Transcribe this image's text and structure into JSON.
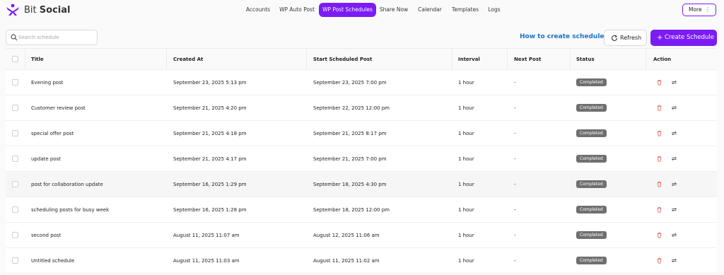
{
  "app": {
    "brand_part1": "Bit",
    "brand_part2": "Social"
  },
  "nav": {
    "items": [
      {
        "label": "Accounts",
        "active": false
      },
      {
        "label": "WP Auto Post",
        "active": false
      },
      {
        "label": "WP Post Schedules",
        "active": true
      },
      {
        "label": "Share Now",
        "active": false
      },
      {
        "label": "Calendar",
        "active": false
      },
      {
        "label": "Templates",
        "active": false
      },
      {
        "label": "Logs",
        "active": false
      }
    ],
    "more_label": "More",
    "more_icon": "vertical-dots-icon"
  },
  "toolbar": {
    "search_placeholder": "Search schedule",
    "howto_label": "How to create schedule",
    "howto_icon": "external-arrow-icon",
    "refresh_label": "Refresh",
    "create_label": "Create Schedule"
  },
  "colors": {
    "accent": "#7c1cf5",
    "link": "#1d72c9",
    "badge_bg": "#6f6f6f",
    "delete_icon": "#e05555"
  },
  "table": {
    "columns": [
      "Title",
      "Created At",
      "Start Scheduled Post",
      "Interval",
      "Next Post",
      "Status",
      "Action"
    ],
    "rows": [
      {
        "title": "Evening post",
        "created": "September 23, 2025 5:13 pm",
        "start": "September 23, 2025 7:00 pm",
        "interval": "1 hour",
        "next": "-",
        "status": "Completed"
      },
      {
        "title": "Customer review post",
        "created": "September 21, 2025 4:20 pm",
        "start": "September 22, 2025 12:00 pm",
        "interval": "1 hour",
        "next": "-",
        "status": "Completed"
      },
      {
        "title": "special offer post",
        "created": "September 21, 2025 4:18 pm",
        "start": "September 21, 2025 8:17 pm",
        "interval": "1 hour",
        "next": "-",
        "status": "Completed"
      },
      {
        "title": "update post",
        "created": "September 21, 2025 4:17 pm",
        "start": "September 21, 2025 7:00 pm",
        "interval": "1 hour",
        "next": "-",
        "status": "Completed"
      },
      {
        "title": "post for collaboration update",
        "created": "September 16, 2025 1:29 pm",
        "start": "September 18, 2025 4:30 pm",
        "interval": "1 hour",
        "next": "-",
        "status": "Completed"
      },
      {
        "title": "scheduling posts for busy week",
        "created": "September 16, 2025 1:28 pm",
        "start": "September 18, 2025 12:00 pm",
        "interval": "1 hour",
        "next": "-",
        "status": "Completed"
      },
      {
        "title": "second post",
        "created": "August 11, 2025 11:07 am",
        "start": "August 12, 2025 11:06 am",
        "interval": "1 hour",
        "next": "-",
        "status": "Completed"
      },
      {
        "title": "Untitled schedule",
        "created": "August 11, 2025 11:03 am",
        "start": "August 11, 2025 11:02 am",
        "interval": "1 hour",
        "next": "-",
        "status": "Completed"
      }
    ],
    "action_icons": [
      "trash-icon",
      "repeat-icon"
    ]
  }
}
